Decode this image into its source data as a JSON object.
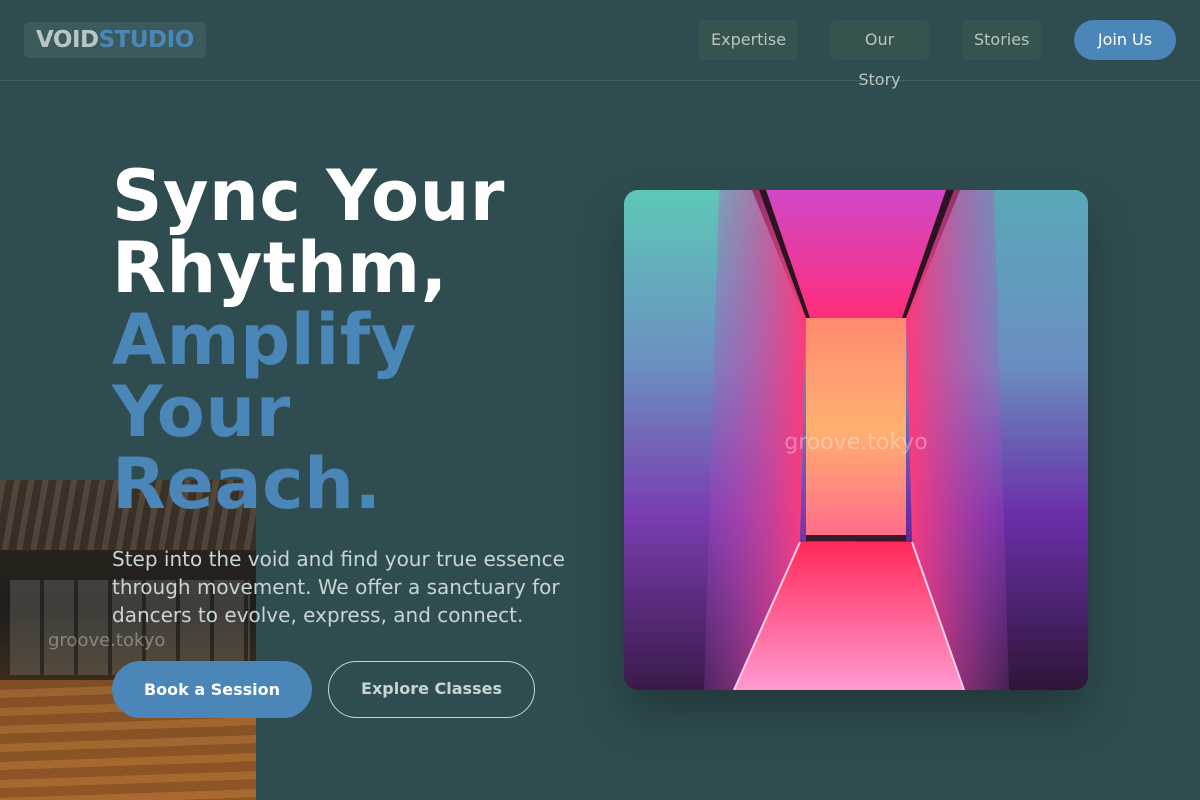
{
  "nav": {
    "logo_part1": "VOID",
    "logo_part2": "STUDIO",
    "links": [
      "Expertise",
      "Our Story",
      "Stories"
    ],
    "cta": "Join Us"
  },
  "hero": {
    "headline_line1": "Sync Your",
    "headline_line2": "Rhythm,",
    "headline_line3": "Amplify",
    "headline_line4": "Your",
    "headline_line5": "Reach.",
    "subtitle": "Step into the void and find your true essence through movement. We offer a sanctuary for dancers to evolve, express, and connect.",
    "primary_button": "Book a Session",
    "secondary_button": "Explore Classes",
    "image_watermark": "groove.tokyo"
  },
  "studio_photo": {
    "watermark": "groove.tokyo"
  },
  "colors": {
    "background": "#2f4d50",
    "accent": "#4a86b8",
    "text": "#ffffff",
    "muted": "#c9d4d3"
  }
}
